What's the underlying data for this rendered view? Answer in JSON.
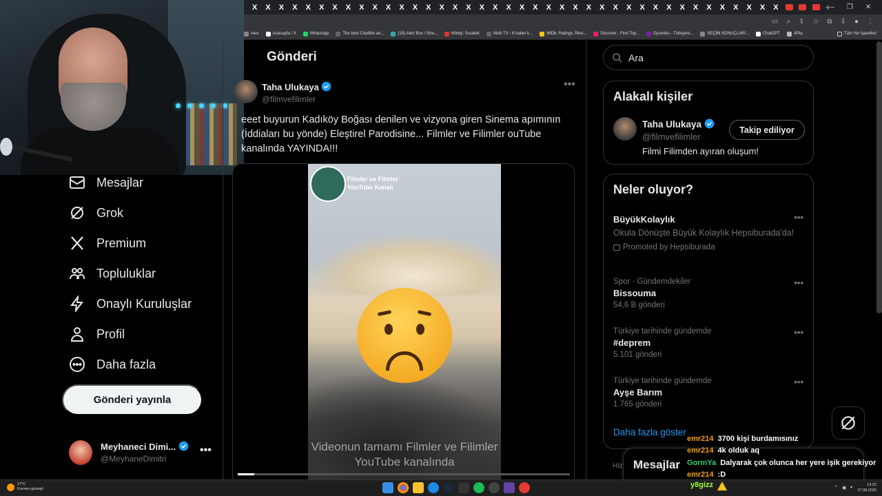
{
  "browser": {
    "tabs": [
      "X",
      "X",
      "X",
      "X",
      "X",
      "X",
      "X",
      "X",
      "X",
      "X",
      "X",
      "X",
      "X",
      "X",
      "X",
      "X",
      "X",
      "X",
      "X",
      "X",
      "X",
      "X",
      "X",
      "X",
      "X",
      "X",
      "X",
      "X",
      "X",
      "X",
      "X",
      "X",
      "X",
      "X",
      "X",
      "X",
      "X",
      "X",
      "X",
      "X"
    ],
    "red_tabs": 3,
    "new_tab": "+",
    "window_controls": [
      "–",
      "❐",
      "✕"
    ],
    "bookmarks": [
      "ners",
      "Anasayfa / X",
      "WhatsApp",
      "The best ChatBot an...",
      "(19) Alert Box / Stre...",
      "Windy: Sıcaklık",
      "Multi TV - 6 haber k...",
      "IMDb: Ratings, Revi...",
      "Discover - Find Top...",
      "Oyuneks - Türkiyeni...",
      "SEÇİM SONUÇLARI...",
      "ChatGPT",
      "APiq"
    ],
    "bookmarks_right": "Tüm Yer İşaretleri"
  },
  "sidebar": {
    "items": [
      {
        "label": "Mesajlar",
        "icon": "envelope-icon"
      },
      {
        "label": "Grok",
        "icon": "grok-icon"
      },
      {
        "label": "Premium",
        "icon": "x-logo-icon"
      },
      {
        "label": "Topluluklar",
        "icon": "people-icon"
      },
      {
        "label": "Onaylı Kuruluşlar",
        "icon": "lightning-icon"
      },
      {
        "label": "Profil",
        "icon": "person-icon"
      },
      {
        "label": "Daha fazla",
        "icon": "more-circle-icon"
      }
    ],
    "post_button": "Gönderi yayınla",
    "profile": {
      "name": "Meyhaneci Dimi...",
      "handle": "@MeyhaneDimitri",
      "more": "•••"
    }
  },
  "main": {
    "header": "Gönderi",
    "tweet": {
      "author": "Taha Ulukaya",
      "handle": "@filmvefilimler",
      "more": "•••",
      "text": "eeet buyurun Kadıköy Boğası denilen ve vizyona giren Sinema apımının (İddiaları bu yönde) Eleştirel Parodisine... Filmler ve Filimler ouTube kanalında YAYINDA!!!",
      "video": {
        "brand": "Filmler ve Filmler YouTube Kanalı",
        "caption": "Videonun tamamı Filmler ve Filimler YouTube kanalında",
        "progress": 0.05
      }
    }
  },
  "right": {
    "search_placeholder": "Ara",
    "relevant": {
      "title": "Alakalı kişiler",
      "name": "Taha Ulukaya",
      "handle": "@filmvefilimler",
      "bio": "Filmi Filimden ayıran oluşum!",
      "follow": "Takip ediliyor"
    },
    "trends_title": "Neler oluyor?",
    "trends": [
      {
        "meta": "",
        "title": "BüyükKolaylık",
        "sub": "Okula Dönüşte Büyük Kolaylık Hepsiburada'da!",
        "promo": "Promoted by Hepsiburada",
        "count": ""
      },
      {
        "meta": "Spor · Gündemdekiler",
        "title": "Bissouma",
        "sub": "",
        "promo": "",
        "count": "54,6 B gönderi"
      },
      {
        "meta": "Türkiye tarihinde gündemde",
        "title": "#deprem",
        "sub": "",
        "promo": "",
        "count": "5.101 gönderi"
      },
      {
        "meta": "Türkiye tarihinde gündemde",
        "title": "Ayşe Barım",
        "sub": "",
        "promo": "",
        "count": "1.765 gönderi"
      }
    ],
    "show_more": "Daha fazla göster",
    "messages_title": "Mesajlar",
    "footer_partial": "Hiz"
  },
  "chat": [
    {
      "user": "emr214",
      "msg": "3700 kişi burdamısınız",
      "color": "#f39c12"
    },
    {
      "user": "emr214",
      "msg": "4k olduk aq",
      "color": "#f39c12"
    },
    {
      "user": "GormYa",
      "msg": "Dalyarak çok olunca her yere işik gerekiyor",
      "color": "#2ecc71"
    },
    {
      "user": "emr214",
      "msg": ":D",
      "color": "#f39c12"
    }
  ],
  "taskbar": {
    "weather_temp": "27°C",
    "weather_desc": "Kısmen güneşli",
    "time": "13:22",
    "date": "27.08.2025",
    "viewer": "y8gizz"
  },
  "colors": {
    "accent": "#1d9bf0",
    "bg": "#000000",
    "border": "#2f3336",
    "muted": "#71767b"
  }
}
